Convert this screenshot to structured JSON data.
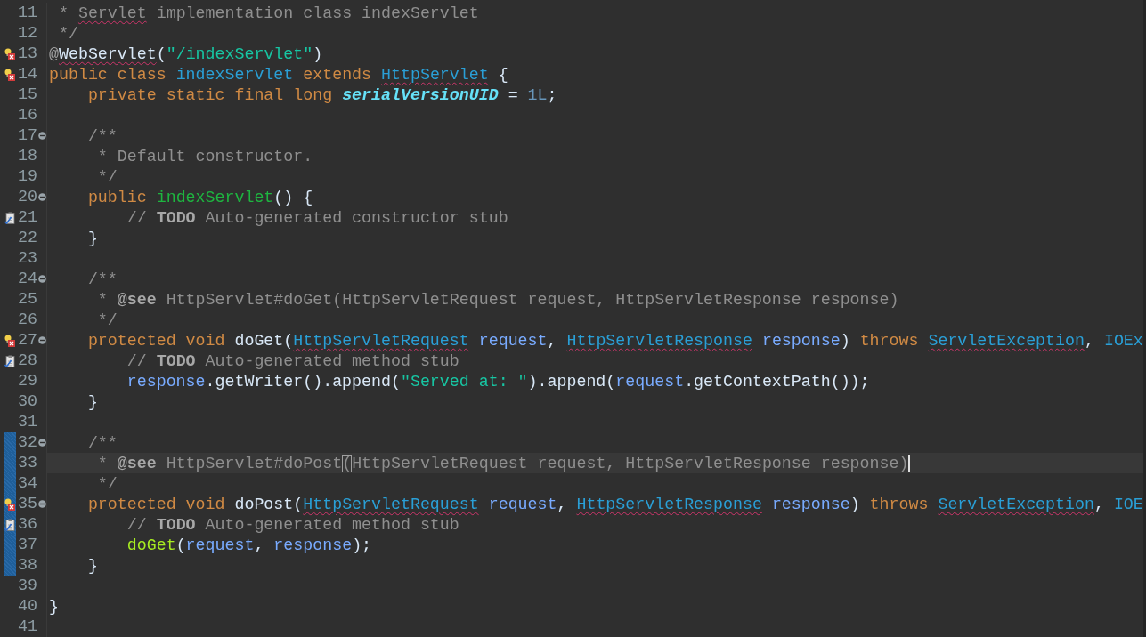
{
  "editor": {
    "lines": [
      {
        "number": "11",
        "tokens": [
          {
            "kind": "comment",
            "text": " * "
          },
          {
            "kind": "comment",
            "text": "Servlet",
            "underlined": true
          },
          {
            "kind": "comment",
            "text": " implementation class indexServlet"
          }
        ]
      },
      {
        "number": "12",
        "tokens": [
          {
            "kind": "comment",
            "text": " */"
          }
        ]
      },
      {
        "number": "13",
        "error": true,
        "tokens": [
          {
            "kind": "annotation",
            "text": "@"
          },
          {
            "kind": "plain",
            "text": "WebServlet",
            "underlined": true
          },
          {
            "kind": "plain",
            "text": "("
          },
          {
            "kind": "string",
            "text": "\"/indexServlet\""
          },
          {
            "kind": "plain",
            "text": ")"
          }
        ]
      },
      {
        "number": "14",
        "error": true,
        "tokens": [
          {
            "kind": "keyword",
            "text": "public class "
          },
          {
            "kind": "type",
            "text": "indexServlet"
          },
          {
            "kind": "keyword",
            "text": " extends "
          },
          {
            "kind": "type",
            "text": "HttpServlet",
            "underlined": true
          },
          {
            "kind": "plain",
            "text": " {"
          }
        ]
      },
      {
        "number": "15",
        "tokens": [
          {
            "kind": "keyword",
            "text": "    private static final long "
          },
          {
            "kind": "field",
            "text": "serialVersionUID"
          },
          {
            "kind": "plain",
            "text": " = "
          },
          {
            "kind": "number",
            "text": "1L"
          },
          {
            "kind": "plain",
            "text": ";"
          }
        ]
      },
      {
        "number": "16"
      },
      {
        "number": "17",
        "foldable": true,
        "tokens": [
          {
            "kind": "comment",
            "text": "    /**"
          }
        ]
      },
      {
        "number": "18",
        "tokens": [
          {
            "kind": "comment",
            "text": "     * Default constructor."
          }
        ]
      },
      {
        "number": "19",
        "tokens": [
          {
            "kind": "comment",
            "text": "     */"
          }
        ]
      },
      {
        "number": "20",
        "foldable": true,
        "tokens": [
          {
            "kind": "keyword",
            "text": "    public "
          },
          {
            "kind": "method_decl",
            "text": "indexServlet"
          },
          {
            "kind": "plain",
            "text": "() {"
          }
        ]
      },
      {
        "number": "21",
        "task": true,
        "tokens": [
          {
            "kind": "comment",
            "text": "        // "
          },
          {
            "kind": "tag",
            "text": "TODO"
          },
          {
            "kind": "comment",
            "text": " Auto-generated constructor stub"
          }
        ]
      },
      {
        "number": "22",
        "tokens": [
          {
            "kind": "plain",
            "text": "    }"
          }
        ]
      },
      {
        "number": "23"
      },
      {
        "number": "24",
        "foldable": true,
        "tokens": [
          {
            "kind": "comment",
            "text": "    /**"
          }
        ]
      },
      {
        "number": "25",
        "tokens": [
          {
            "kind": "comment",
            "text": "     * "
          },
          {
            "kind": "tag",
            "text": "@see"
          },
          {
            "kind": "comment",
            "text": " HttpServlet#doGet(HttpServletRequest request, HttpServletResponse response)"
          }
        ]
      },
      {
        "number": "26",
        "tokens": [
          {
            "kind": "comment",
            "text": "     */"
          }
        ]
      },
      {
        "number": "27",
        "error": true,
        "foldable": true,
        "tokens": [
          {
            "kind": "keyword",
            "text": "    protected void "
          },
          {
            "kind": "plain",
            "text": "doGet("
          },
          {
            "kind": "type",
            "text": "HttpServletRequest",
            "underlined": true
          },
          {
            "kind": "param",
            "text": " request"
          },
          {
            "kind": "plain",
            "text": ", "
          },
          {
            "kind": "type",
            "text": "HttpServletResponse",
            "underlined": true
          },
          {
            "kind": "param",
            "text": " response"
          },
          {
            "kind": "plain",
            "text": ") "
          },
          {
            "kind": "keyword",
            "text": "throws "
          },
          {
            "kind": "type",
            "text": "ServletException",
            "underlined": true
          },
          {
            "kind": "plain",
            "text": ", "
          },
          {
            "kind": "type",
            "text": "IOEx"
          }
        ]
      },
      {
        "number": "28",
        "task": true,
        "tokens": [
          {
            "kind": "comment",
            "text": "        // "
          },
          {
            "kind": "tag",
            "text": "TODO"
          },
          {
            "kind": "comment",
            "text": " Auto-generated method stub"
          }
        ]
      },
      {
        "number": "29",
        "tokens": [
          {
            "kind": "param",
            "text": "        response"
          },
          {
            "kind": "plain",
            "text": ".getWriter().append("
          },
          {
            "kind": "string",
            "text": "\"Served at: \""
          },
          {
            "kind": "plain",
            "text": ").append("
          },
          {
            "kind": "param",
            "text": "request"
          },
          {
            "kind": "plain",
            "text": ".getContextPath());"
          }
        ]
      },
      {
        "number": "30",
        "tokens": [
          {
            "kind": "plain",
            "text": "    }"
          }
        ]
      },
      {
        "number": "31"
      },
      {
        "number": "32",
        "changed": true,
        "foldable": true,
        "tokens": [
          {
            "kind": "comment",
            "text": "    /**"
          }
        ]
      },
      {
        "number": "33",
        "changed": true,
        "current": true,
        "tokens": [
          {
            "kind": "comment",
            "text": "     * "
          },
          {
            "kind": "tag",
            "text": "@see"
          },
          {
            "kind": "comment",
            "text": " HttpServlet#doPost"
          },
          {
            "kind": "bracket_match",
            "text": "("
          },
          {
            "kind": "comment",
            "text": "HttpServletRequest request, HttpServletResponse response)"
          }
        ]
      },
      {
        "number": "34",
        "changed": true,
        "tokens": [
          {
            "kind": "comment",
            "text": "     */"
          }
        ]
      },
      {
        "number": "35",
        "changed": true,
        "error": true,
        "foldable": true,
        "tokens": [
          {
            "kind": "keyword",
            "text": "    protected void "
          },
          {
            "kind": "plain",
            "text": "doPost("
          },
          {
            "kind": "type",
            "text": "HttpServletRequest",
            "underlined": true
          },
          {
            "kind": "param",
            "text": " request"
          },
          {
            "kind": "plain",
            "text": ", "
          },
          {
            "kind": "type",
            "text": "HttpServletResponse",
            "underlined": true
          },
          {
            "kind": "param",
            "text": " response"
          },
          {
            "kind": "plain",
            "text": ") "
          },
          {
            "kind": "keyword",
            "text": "throws "
          },
          {
            "kind": "type",
            "text": "ServletException",
            "underlined": true
          },
          {
            "kind": "plain",
            "text": ", "
          },
          {
            "kind": "type",
            "text": "IOE"
          }
        ]
      },
      {
        "number": "36",
        "changed": true,
        "task": true,
        "tokens": [
          {
            "kind": "comment",
            "text": "        // "
          },
          {
            "kind": "tag",
            "text": "TODO"
          },
          {
            "kind": "comment",
            "text": " Auto-generated method stub"
          }
        ]
      },
      {
        "number": "37",
        "changed": true,
        "tokens": [
          {
            "kind": "method_call",
            "text": "        doGet"
          },
          {
            "kind": "plain",
            "text": "("
          },
          {
            "kind": "param",
            "text": "request"
          },
          {
            "kind": "plain",
            "text": ", "
          },
          {
            "kind": "param",
            "text": "response"
          },
          {
            "kind": "plain",
            "text": ");"
          }
        ]
      },
      {
        "number": "38",
        "changed": true,
        "tokens": [
          {
            "kind": "plain",
            "text": "    }"
          }
        ]
      },
      {
        "number": "39"
      },
      {
        "number": "40",
        "tokens": [
          {
            "kind": "plain",
            "text": "}"
          }
        ]
      },
      {
        "number": "41"
      }
    ]
  }
}
